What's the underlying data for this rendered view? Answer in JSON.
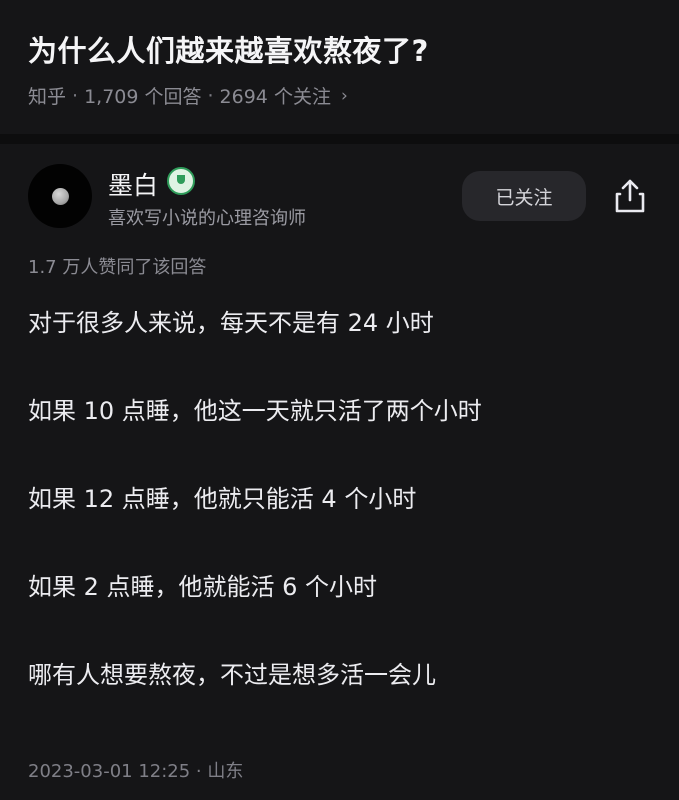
{
  "question": {
    "title": "为什么人们越来越喜欢熬夜了?",
    "source": "知乎",
    "answers": "1,709 个回答",
    "followers": "2694 个关注",
    "separator": "·",
    "chevron": "›"
  },
  "author": {
    "name": "墨白",
    "bio": "喜欢写小说的心理咨询师",
    "badge_icon": "verified-trophy-icon",
    "follow_label": "已关注"
  },
  "answer": {
    "likes": "1.7 万人赞同了该回答",
    "paragraphs": [
      "对于很多人来说，每天不是有 24 小时",
      "如果 10 点睡，他这一天就只活了两个小时",
      "如果 12 点睡，他就只能活 4 个小时",
      "如果 2 点睡，他就能活 6 个小时",
      "哪有人想要熬夜，不过是想多活一会儿"
    ],
    "timestamp": "2023-03-01 12:25 · 山东"
  },
  "colors": {
    "background": "#151517",
    "text": "#ececf0",
    "muted": "#8b8b93",
    "badge_green": "#2f9c5a",
    "button_bg": "#27272b"
  }
}
